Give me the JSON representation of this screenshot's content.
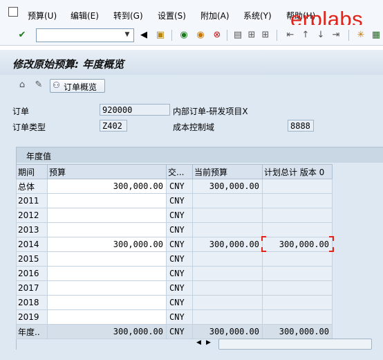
{
  "menu": {
    "items": [
      "预算(U)",
      "编辑(E)",
      "转到(G)",
      "设置(S)",
      "附加(A)",
      "系统(Y)",
      "帮助(H)"
    ]
  },
  "watermark": "erplabs",
  "toolbar": {
    "icons": [
      "enter-icon",
      "back-icon",
      "save-icon",
      "back-green-icon",
      "exit-icon",
      "cancel-icon",
      "print-icon",
      "find-icon",
      "find-next-icon",
      "first-page-icon",
      "prev-page-icon",
      "next-page-icon",
      "last-page-icon",
      "create-session-icon",
      "shortcut-icon"
    ]
  },
  "title": "修改原始预算: 年度概览",
  "app_toolbar": {
    "order_overview_label": "订单概览"
  },
  "header": {
    "order_label": "订单",
    "order_value": "920000",
    "order_desc": "内部订单-研发项目X",
    "order_type_label": "订单类型",
    "order_type_value": "Z402",
    "controlling_area_label": "成本控制域",
    "controlling_area_value": "8888"
  },
  "table": {
    "group_title": "年度值",
    "columns": [
      "期间",
      "预算",
      "交...",
      "当前预算",
      "计划总计 版本 0"
    ],
    "rows": [
      {
        "period": "总体",
        "budget": "300,000.00",
        "currency": "CNY",
        "current": "300,000.00",
        "plan": ""
      },
      {
        "period": "2011",
        "budget": "",
        "currency": "CNY",
        "current": "",
        "plan": ""
      },
      {
        "period": "2012",
        "budget": "",
        "currency": "CNY",
        "current": "",
        "plan": ""
      },
      {
        "period": "2013",
        "budget": "",
        "currency": "CNY",
        "current": "",
        "plan": ""
      },
      {
        "period": "2014",
        "budget": "300,000.00",
        "currency": "CNY",
        "current": "300,000.00",
        "plan": "300,000.00"
      },
      {
        "period": "2015",
        "budget": "",
        "currency": "CNY",
        "current": "",
        "plan": ""
      },
      {
        "period": "2016",
        "budget": "",
        "currency": "CNY",
        "current": "",
        "plan": ""
      },
      {
        "period": "2017",
        "budget": "",
        "currency": "CNY",
        "current": "",
        "plan": ""
      },
      {
        "period": "2018",
        "budget": "",
        "currency": "CNY",
        "current": "",
        "plan": ""
      },
      {
        "period": "2019",
        "budget": "",
        "currency": "CNY",
        "current": "",
        "plan": ""
      }
    ],
    "total_row": {
      "period": "年度..",
      "budget": "300,000.00",
      "currency": "CNY",
      "current": "300,000.00",
      "plan": "300,000.00"
    }
  }
}
